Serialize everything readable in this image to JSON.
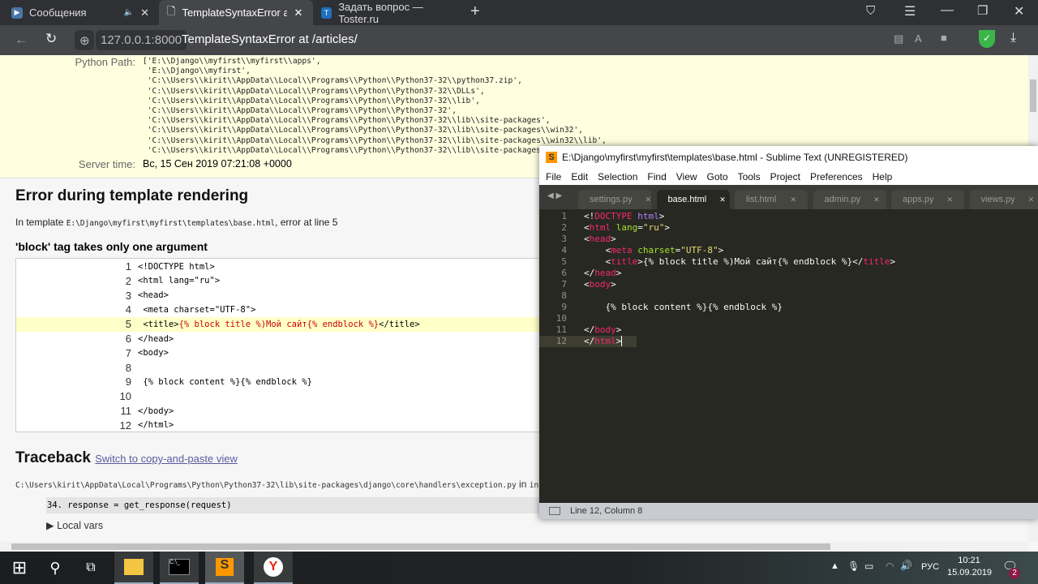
{
  "browser": {
    "tabs": [
      {
        "title": "Сообщения",
        "icon": "play-icon",
        "color": "#4a76a8"
      },
      {
        "title": "TemplateSyntaxError at /",
        "icon": "document-icon"
      },
      {
        "title": "Задать вопрос — Toster.ru",
        "icon": "toster-icon",
        "color": "#1e6fbf"
      }
    ],
    "host": "127.0.0.1:8000",
    "page_title": "TemplateSyntaxError at /articles/"
  },
  "summary": {
    "python_path_label": "Python Path:",
    "python_path": "['E:\\\\Django\\\\myfirst\\\\myfirst\\\\apps',\n 'E:\\\\Django\\\\myfirst',\n 'C:\\\\Users\\\\kirit\\\\AppData\\\\Local\\\\Programs\\\\Python\\\\Python37-32\\\\python37.zip',\n 'C:\\\\Users\\\\kirit\\\\AppData\\\\Local\\\\Programs\\\\Python\\\\Python37-32\\\\DLLs',\n 'C:\\\\Users\\\\kirit\\\\AppData\\\\Local\\\\Programs\\\\Python\\\\Python37-32\\\\lib',\n 'C:\\\\Users\\\\kirit\\\\AppData\\\\Local\\\\Programs\\\\Python\\\\Python37-32',\n 'C:\\\\Users\\\\kirit\\\\AppData\\\\Local\\\\Programs\\\\Python\\\\Python37-32\\\\lib\\\\site-packages',\n 'C:\\\\Users\\\\kirit\\\\AppData\\\\Local\\\\Programs\\\\Python\\\\Python37-32\\\\lib\\\\site-packages\\\\win32',\n 'C:\\\\Users\\\\kirit\\\\AppData\\\\Local\\\\Programs\\\\Python\\\\Python37-32\\\\lib\\\\site-packages\\\\win32\\\\lib',\n 'C:\\\\Users\\\\kirit\\\\AppData\\\\Local\\\\Programs\\\\Python\\\\Python37-32\\\\lib\\\\site-packages\\\\Pythonwin']",
    "server_time_label": "Server time:",
    "server_time": "Вс, 15 Сен 2019 07:21:08 +0000"
  },
  "template": {
    "heading": "Error during template rendering",
    "in_template": "In template ",
    "path": "E:\\Django\\myfirst\\myfirst\\templates\\base.html",
    "error_at": ", error at line ",
    "line": "5",
    "message": "'block' tag takes only one argument",
    "lines": [
      {
        "n": "1",
        "pre": "<!DOCTYPE html>"
      },
      {
        "n": "2",
        "pre": "<html lang=\"ru\">"
      },
      {
        "n": "3",
        "pre": "<head>"
      },
      {
        "n": "4",
        "pre": " <meta charset=\"UTF-8\">"
      },
      {
        "n": "5",
        "pre": " <title>",
        "err": "{% block title %)Мой сайт{% endblock %}",
        "post": "</title>",
        "highlight": true
      },
      {
        "n": "6",
        "pre": "</head>"
      },
      {
        "n": "7",
        "pre": "<body>"
      },
      {
        "n": "8",
        "pre": ""
      },
      {
        "n": "9",
        "pre": " {% block content %}{% endblock %}"
      },
      {
        "n": "10",
        "pre": ""
      },
      {
        "n": "11",
        "pre": "</body>"
      },
      {
        "n": "12",
        "pre": "</html>"
      }
    ]
  },
  "traceback": {
    "heading": "Traceback",
    "switch_link": "Switch to copy-and-paste view",
    "file": "C:\\Users\\kirit\\AppData\\Local\\Programs\\Python\\Python37-32\\lib\\site-packages\\django\\core\\handlers\\exception.py",
    "in": " in ",
    "func": "inner",
    "code": "34.  response = get_response(request)",
    "local_vars": "Local vars"
  },
  "sublime": {
    "title": "E:\\Django\\myfirst\\myfirst\\templates\\base.html - Sublime Text (UNREGISTERED)",
    "menu": [
      "File",
      "Edit",
      "Selection",
      "Find",
      "View",
      "Goto",
      "Tools",
      "Project",
      "Preferences",
      "Help"
    ],
    "tabs": [
      {
        "label": "settings.py"
      },
      {
        "label": "base.html",
        "active": true
      },
      {
        "label": "list.html"
      },
      {
        "label": "admin.py"
      },
      {
        "label": "apps.py"
      },
      {
        "label": "views.py"
      }
    ],
    "code": [
      [
        [
          "<!",
          "p"
        ],
        [
          "DOCTYPE",
          "k"
        ],
        [
          " ",
          "p"
        ],
        [
          "html",
          "d"
        ],
        [
          ">",
          "p"
        ]
      ],
      [
        [
          "<",
          "p"
        ],
        [
          "html",
          "k"
        ],
        [
          " ",
          "p"
        ],
        [
          "lang",
          "a"
        ],
        [
          "=",
          "p"
        ],
        [
          "\"ru\"",
          "s"
        ],
        [
          ">",
          "p"
        ]
      ],
      [
        [
          "<",
          "p"
        ],
        [
          "head",
          "k"
        ],
        [
          ">",
          "p"
        ]
      ],
      [
        [
          "    <",
          "p"
        ],
        [
          "meta",
          "k"
        ],
        [
          " ",
          "p"
        ],
        [
          "charset",
          "a"
        ],
        [
          "=",
          "p"
        ],
        [
          "\"UTF-8\"",
          "s"
        ],
        [
          ">",
          "p"
        ]
      ],
      [
        [
          "    <",
          "p"
        ],
        [
          "title",
          "k"
        ],
        [
          ">{% block title %)Мой сайт{% endblock %}</",
          "p"
        ],
        [
          "title",
          "k"
        ],
        [
          ">",
          "p"
        ]
      ],
      [
        [
          "</",
          "p"
        ],
        [
          "head",
          "k"
        ],
        [
          ">",
          "p"
        ]
      ],
      [
        [
          "<",
          "p"
        ],
        [
          "body",
          "k"
        ],
        [
          ">",
          "p"
        ]
      ],
      [],
      [
        [
          "    {% block content %}{% endblock %}",
          "p"
        ]
      ],
      [],
      [
        [
          "</",
          "p"
        ],
        [
          "body",
          "k"
        ],
        [
          ">",
          "p"
        ]
      ],
      [
        [
          "</",
          "p"
        ],
        [
          "html",
          "k"
        ],
        [
          ">",
          "p"
        ]
      ]
    ],
    "status": "Line 12, Column 8"
  },
  "taskbar": {
    "lang": "РУС",
    "time": "10:21",
    "date": "15.09.2019",
    "notifications": "2"
  }
}
